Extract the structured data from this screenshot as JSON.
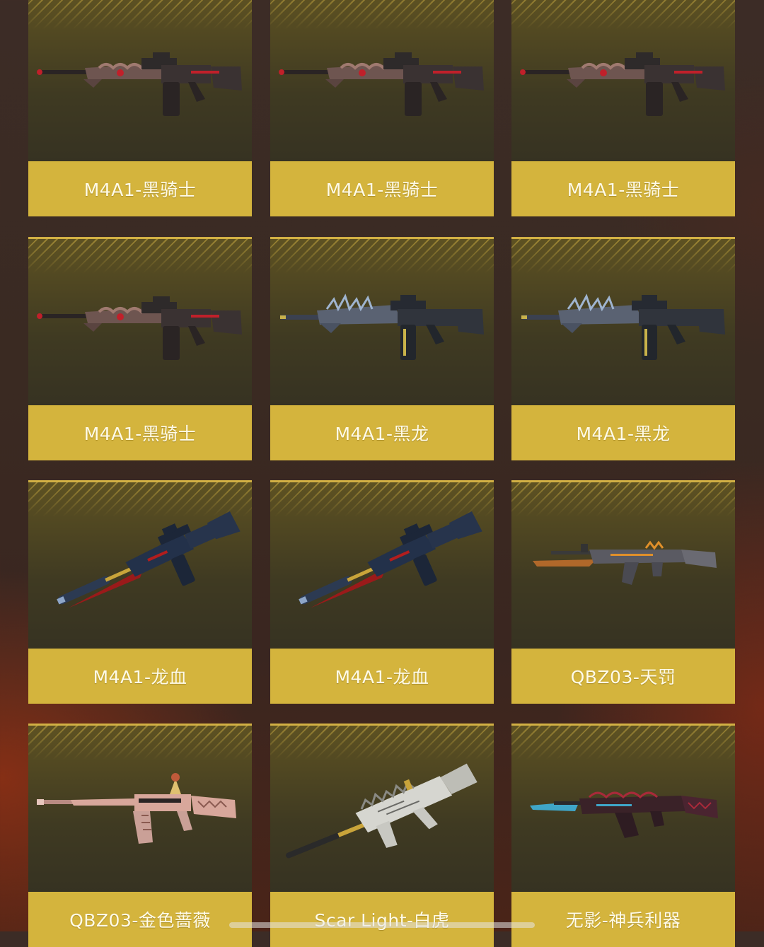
{
  "items": [
    {
      "name": "M4A1-黑骑士",
      "gun_icon": "m4a1-black-knight-rifle-icon"
    },
    {
      "name": "M4A1-黑骑士",
      "gun_icon": "m4a1-black-knight-rifle-icon"
    },
    {
      "name": "M4A1-黑骑士",
      "gun_icon": "m4a1-black-knight-rifle-icon"
    },
    {
      "name": "M4A1-黑骑士",
      "gun_icon": "m4a1-black-knight-rifle-icon"
    },
    {
      "name": "M4A1-黑龙",
      "gun_icon": "m4a1-black-dragon-rifle-icon"
    },
    {
      "name": "M4A1-黑龙",
      "gun_icon": "m4a1-black-dragon-rifle-icon"
    },
    {
      "name": "M4A1-龙血",
      "gun_icon": "m4a1-dragon-blood-rifle-icon"
    },
    {
      "name": "M4A1-龙血",
      "gun_icon": "m4a1-dragon-blood-rifle-icon"
    },
    {
      "name": "QBZ03-天罚",
      "gun_icon": "qbz03-heavenly-punishment-rifle-icon"
    },
    {
      "name": "QBZ03-金色蔷薇",
      "gun_icon": "qbz03-golden-rose-rifle-icon"
    },
    {
      "name": "Scar Light-白虎",
      "gun_icon": "scar-light-white-tiger-rifle-icon"
    },
    {
      "name": "无影-神兵利器",
      "gun_icon": "wuying-divine-weapon-rifle-icon"
    }
  ],
  "colors": {
    "label_bg": "#d4b43d",
    "card_top": "#5e5222",
    "card_bottom": "#2f2c22",
    "knight_accent": "#c0202a",
    "dragon_accent": "#9fb4cf",
    "blood_accent": "#b21d1d",
    "rose_body": "#d8a79b",
    "tiger_body": "#d6d6d0",
    "wuying_accent": "#3fa6c9"
  }
}
